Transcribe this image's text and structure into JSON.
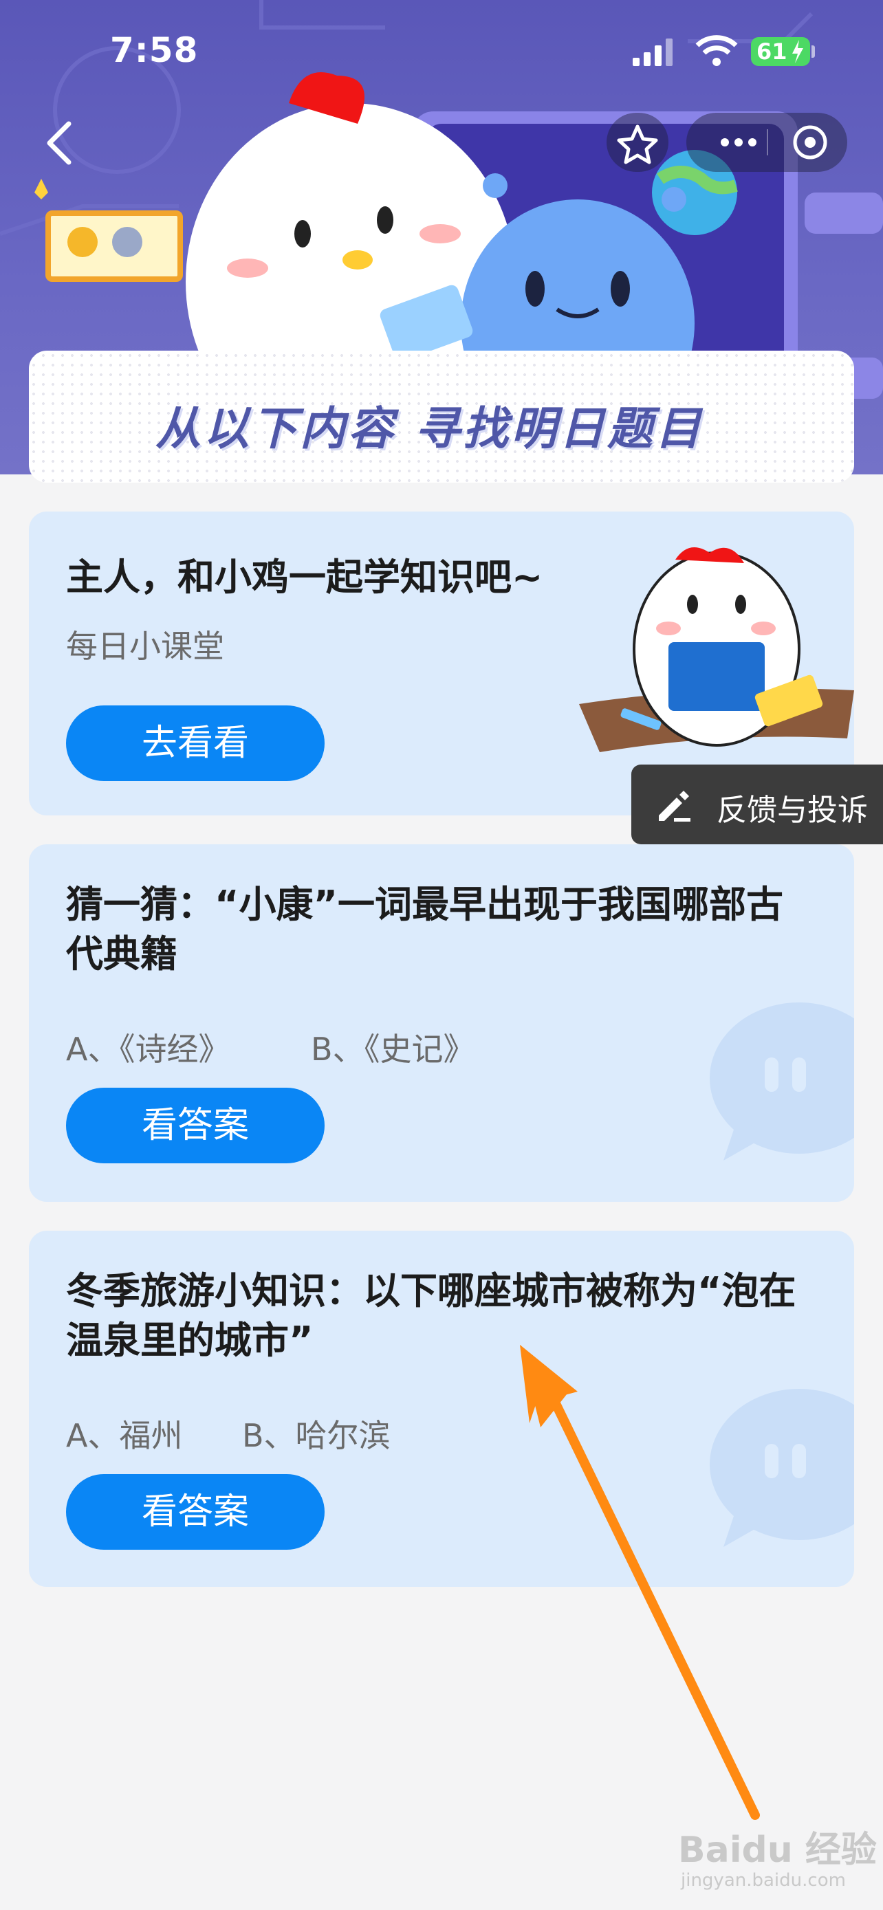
{
  "status_bar": {
    "time": "7:58",
    "battery": "61"
  },
  "headline": {
    "text": "从以下内容 寻找明日题目"
  },
  "cards": [
    {
      "title": "主人，和小鸡一起学知识吧~",
      "subtitle": "每日小课堂",
      "button": "去看看"
    },
    {
      "title": "猜一猜：“小康”一词最早出现于我国哪部古代典籍",
      "option_a": "A、《诗经》",
      "option_b": "B、《史记》",
      "button": "看答案"
    },
    {
      "title": "冬季旅游小知识：以下哪座城市被称为“泡在温泉里的城市”",
      "option_a": "A、福州",
      "option_b": "B、哈尔滨",
      "button": "看答案"
    }
  ],
  "feedback": {
    "label": "反馈与投诉"
  },
  "watermark": {
    "text": "Baidu 经验",
    "sub": "jingyan.baidu.com"
  },
  "colors": {
    "banner": "#5a57b8",
    "card_bg": "#dcebfc",
    "button": "#0a86f5",
    "arrow": "#ff8a12"
  }
}
